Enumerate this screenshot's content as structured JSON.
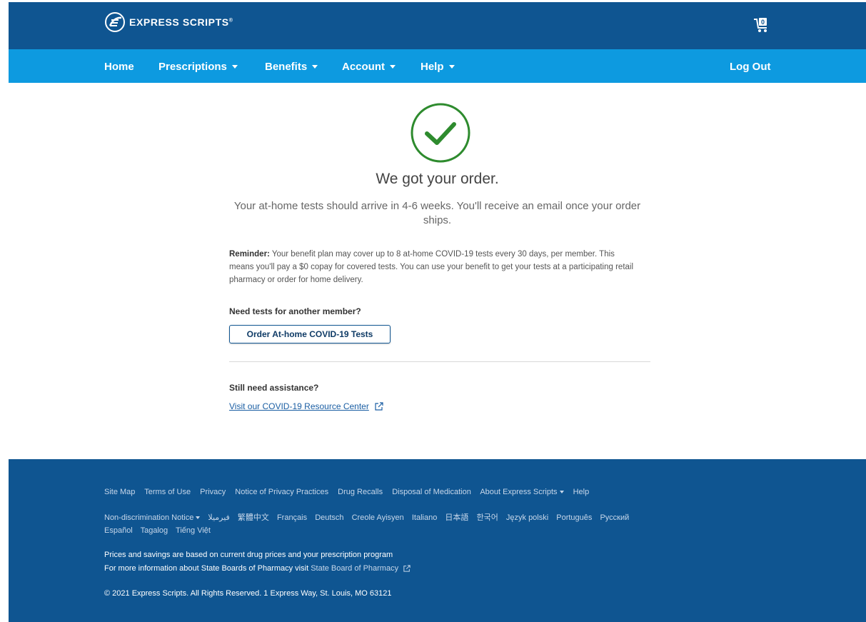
{
  "header": {
    "brand": "EXPRESS SCRIPTS",
    "brand_mark": "®",
    "cart_count": "0",
    "cart_icon": "shopping-cart-icon"
  },
  "nav": {
    "home": "Home",
    "prescriptions": "Prescriptions",
    "benefits": "Benefits",
    "account": "Account",
    "help": "Help",
    "logout": "Log Out"
  },
  "confirmation": {
    "icon": "checkmark-circle-icon",
    "headline": "We got your order.",
    "subtext": "Your at-home tests should arrive in 4-6 weeks. You'll receive an email once your order ships.",
    "reminder_label": "Reminder:",
    "reminder_text": " Your benefit plan may cover up to 8 at-home COVID-19 tests every 30 days, per member. This means you'll pay a $0 copay for covered tests. You can use your benefit to get your tests at a participating retail pharmacy or order for home delivery.",
    "need_tests": "Need tests for another member?",
    "order_button": "Order At-home COVID-19 Tests",
    "still_need": "Still need assistance?",
    "resource_link": "Visit our COVID-19 Resource Center"
  },
  "footer": {
    "links": [
      "Site Map",
      "Terms of Use",
      "Privacy",
      "Notice of Privacy Practices",
      "Drug Recalls",
      "Disposal of Medication",
      "About Express Scripts",
      "Help"
    ],
    "nondiscrimination": "Non-discrimination Notice",
    "languages": [
      "فيرميلا",
      "繁體中文",
      "Français",
      "Deutsch",
      "Creole Ayisyen",
      "Italiano",
      "日本語",
      "한국어",
      "Język polski",
      "Português",
      "Русский"
    ],
    "languages_row2": [
      "Español",
      "Tagalog",
      "Tiếng Việt"
    ],
    "prices_note": "Prices and savings are based on current drug prices and your prescription program",
    "boards_prefix": "For more information about State Boards of Pharmacy visit ",
    "boards_link": "State Board of Pharmacy",
    "copyright": "© 2021 Express Scripts. All Rights Reserved. 1 Express Way, St. Louis, MO 63121"
  },
  "colors": {
    "topbar": "#0f5591",
    "navbar": "#0d9ae0",
    "success_green": "#2e8b2e",
    "footer": "#0f5591"
  }
}
